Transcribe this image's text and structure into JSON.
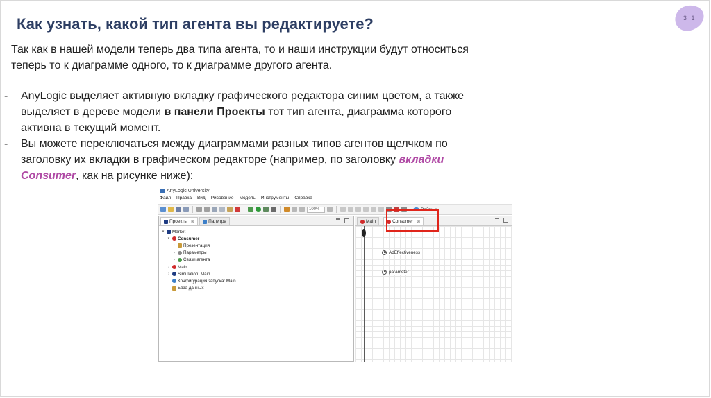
{
  "slide": {
    "page_number": "3 1",
    "title": "Как узнать, какой тип агента вы редактируете?",
    "intro": "Так как в нашей модели теперь два типа агента, то и наши инструкции будут относиться теперь то к диаграмме одного, то к диаграмме другого агента.",
    "bullet1": {
      "dash": "-",
      "text_before": "AnyLogic выделяет активную вкладку графического редактора синим цветом, а также выделяет в дереве модели ",
      "bold_text": "в панели Проекты",
      "text_after": " тот тип агента, диаграмма которого активна в текущий момент."
    },
    "bullet2": {
      "dash": "-",
      "text_before": "Вы можете переключаться между диаграммами разных типов агентов щелчком по заголовку их вкладки в графическом редакторе (например, по заголовку ",
      "accent_text": "вкладки Consumer",
      "text_after": ", как на рисунке ниже):"
    },
    "accent_color": "#b04aa5",
    "title_color": "#2d3e63",
    "highlight_color": "#e0251b"
  },
  "screenshot": {
    "app_title": "AnyLogic University",
    "menu": [
      "Файл",
      "Правка",
      "Вид",
      "Рисование",
      "Модель",
      "Инструменты",
      "Справка"
    ],
    "zoom": "100%",
    "login_label": "Войти",
    "left_tabs": [
      "Проекты",
      "Палитра"
    ],
    "tree": [
      {
        "label": "Market",
        "level": 0,
        "toggle": "▾",
        "icon": "model-icon"
      },
      {
        "label": "Consumer",
        "level": 1,
        "toggle": "▾",
        "icon": "agent-type-icon",
        "bold": true
      },
      {
        "label": "Презентация",
        "level": 2,
        "toggle": "›",
        "icon": "presentation-icon"
      },
      {
        "label": "Параметры",
        "level": 2,
        "toggle": "›",
        "icon": "parameters-icon"
      },
      {
        "label": "Связи агента",
        "level": 2,
        "toggle": "›",
        "icon": "agent-links-icon"
      },
      {
        "label": "Main",
        "level": 1,
        "toggle": "›",
        "icon": "agent-type-icon"
      },
      {
        "label": "Simulation: Main",
        "level": 1,
        "toggle": "›",
        "icon": "experiment-icon"
      },
      {
        "label": "Конфигурация запуска: Main",
        "level": 1,
        "toggle": "",
        "icon": "run-config-icon"
      },
      {
        "label": "База данных",
        "level": 1,
        "toggle": "",
        "icon": "database-icon"
      }
    ],
    "editor_tabs": [
      "Main",
      "Consumer"
    ],
    "canvas_params": [
      "AdEffectiveness",
      "parameter"
    ]
  }
}
